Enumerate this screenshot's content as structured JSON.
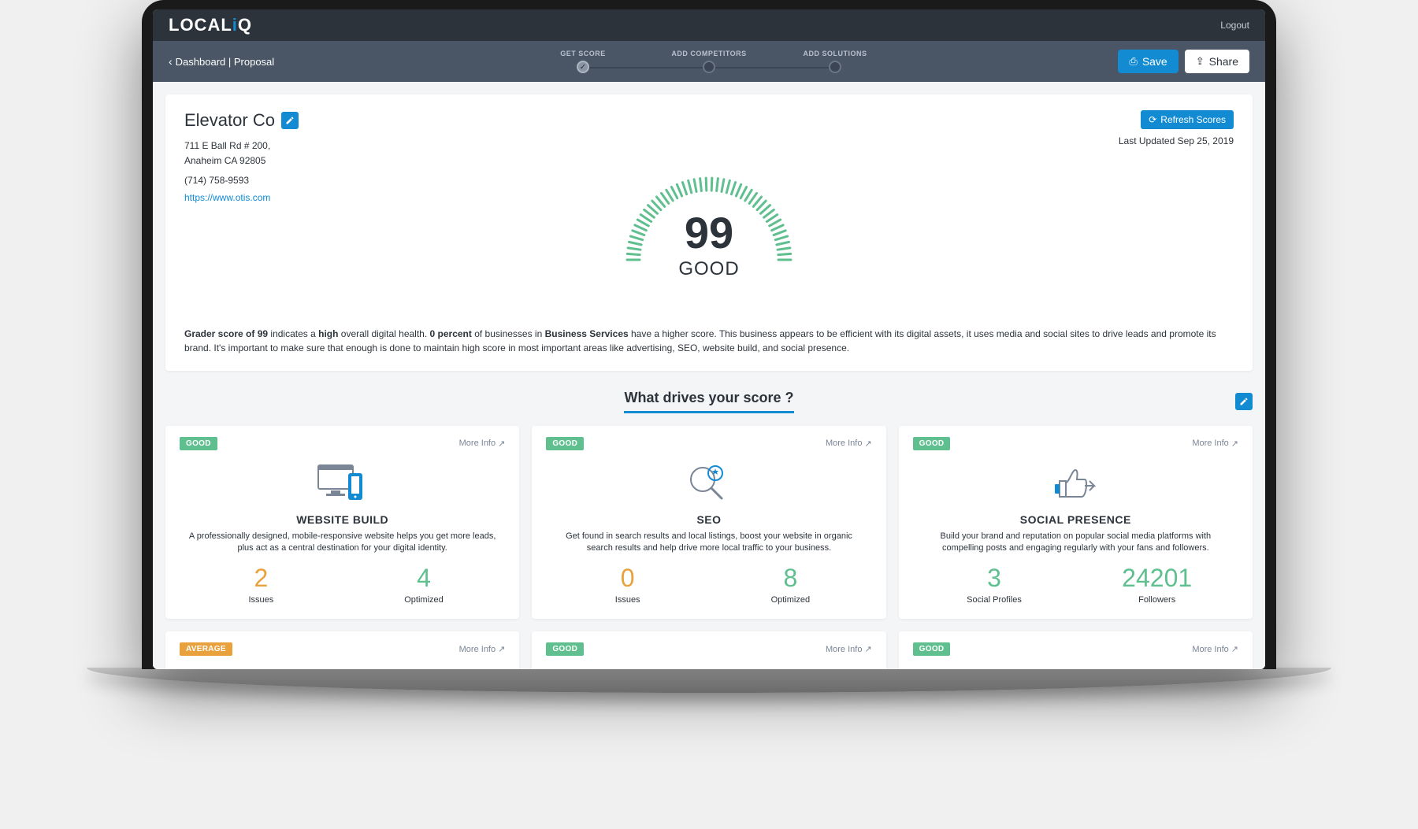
{
  "brand": "LOCALiQ",
  "logout": "Logout",
  "breadcrumb": "Dashboard | Proposal",
  "stepper": {
    "s1": "GET SCORE",
    "s2": "ADD COMPETITORS",
    "s3": "ADD SOLUTIONS"
  },
  "actions": {
    "save": "Save",
    "share": "Share"
  },
  "company": {
    "name": "Elevator Co",
    "addr1": "711 E Ball Rd # 200,",
    "addr2": "Anaheim CA 92805",
    "phone": "(714) 758-9593",
    "url": "https://www.otis.com"
  },
  "refresh": {
    "button": "Refresh Scores",
    "updated": "Last Updated Sep 25, 2019"
  },
  "gauge": {
    "score": "99",
    "label": "GOOD"
  },
  "summary": {
    "pre": "Grader score of 99",
    "mid1": " indicates a ",
    "high": "high",
    "mid2": " overall digital health. ",
    "percent": "0 percent",
    "mid3": " of businesses in ",
    "category": "Business Services",
    "tail": " have a higher score. This business appears to be efficient with its digital assets, it uses media and social sites to drive leads and promote its brand. It's important to make sure that enough is done to maintain high score in most important areas like advertising, SEO, website build, and social presence."
  },
  "sectionTitle": "What drives your score ?",
  "cards": {
    "website": {
      "badge": "GOOD",
      "more": "More Info",
      "title": "WEBSITE BUILD",
      "desc": "A professionally designed, mobile-responsive website helps you get more leads, plus act as a central destination for your digital identity.",
      "stat1": "2",
      "stat1label": "Issues",
      "stat2": "4",
      "stat2label": "Optimized"
    },
    "seo": {
      "badge": "GOOD",
      "more": "More Info",
      "title": "SEO",
      "desc": "Get found in search results and local listings, boost your website in organic search results and help drive more local traffic to your business.",
      "stat1": "0",
      "stat1label": "Issues",
      "stat2": "8",
      "stat2label": "Optimized"
    },
    "social": {
      "badge": "GOOD",
      "more": "More Info",
      "title": "SOCIAL PRESENCE",
      "desc": "Build your brand and reputation on popular social media platforms with compelling posts and engaging regularly with your fans and followers.",
      "stat1": "3",
      "stat1label": "Social Profiles",
      "stat2": "24201",
      "stat2label": "Followers"
    },
    "row2a": {
      "badge": "AVERAGE",
      "more": "More Info"
    },
    "row2b": {
      "badge": "GOOD",
      "more": "More Info"
    },
    "row2c": {
      "badge": "GOOD",
      "more": "More Info"
    }
  }
}
